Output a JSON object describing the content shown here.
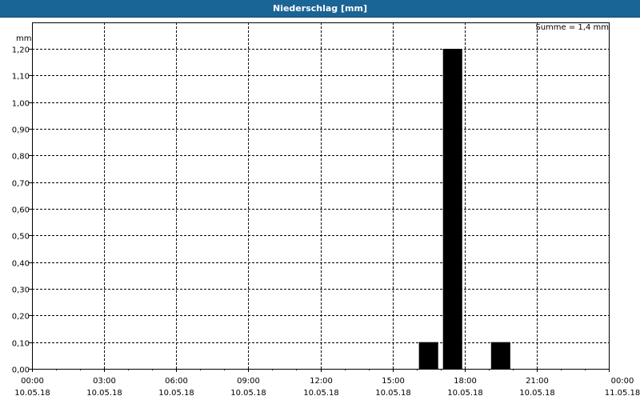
{
  "window": {
    "title": "Niederschlag [mm]"
  },
  "chart_data": {
    "type": "bar",
    "title": "Niederschlag [mm]",
    "unit_label": "mm",
    "sum_annotation": "Summe = 1,4 mm",
    "ylim": [
      0,
      1.2
    ],
    "y_ticks": [
      "0,00",
      "0,10",
      "0,20",
      "0,30",
      "0,40",
      "0,50",
      "0,60",
      "0,70",
      "0,80",
      "0,90",
      "1,00",
      "1,10",
      "1,20"
    ],
    "x_range": [
      "2018-05-10 00:00",
      "2018-05-11 00:00"
    ],
    "x_ticks": [
      {
        "time": "00:00",
        "date": "10.05.18"
      },
      {
        "time": "03:00",
        "date": "10.05.18"
      },
      {
        "time": "06:00",
        "date": "10.05.18"
      },
      {
        "time": "09:00",
        "date": "10.05.18"
      },
      {
        "time": "12:00",
        "date": "10.05.18"
      },
      {
        "time": "15:00",
        "date": "10.05.18"
      },
      {
        "time": "18:00",
        "date": "10.05.18"
      },
      {
        "time": "21:00",
        "date": "10.05.18"
      },
      {
        "time": "00:00",
        "date": "11.05.18"
      }
    ],
    "bars": [
      {
        "start": "16:00",
        "end": "17:00",
        "value": 0.1
      },
      {
        "start": "17:00",
        "end": "18:00",
        "value": 1.2
      },
      {
        "start": "19:00",
        "end": "20:00",
        "value": 0.1
      }
    ],
    "grid": true,
    "bar_color": "#000000"
  }
}
